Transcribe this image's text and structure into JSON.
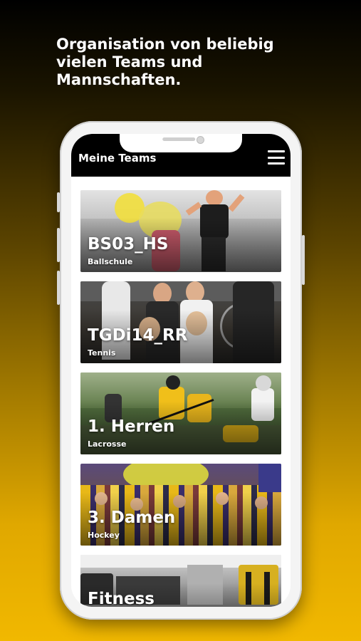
{
  "headline": "Organisation von beliebig\nvielen Teams und\nMannschaften.",
  "app": {
    "title": "Meine Teams",
    "menu_icon": "hamburger-menu-icon"
  },
  "teams": [
    {
      "name": "BS03_HS",
      "sport": "Ballschule"
    },
    {
      "name": "TGDi14_RR",
      "sport": "Tennis"
    },
    {
      "name": "1. Herren",
      "sport": "Lacrosse"
    },
    {
      "name": "3. Damen",
      "sport": "Hockey"
    },
    {
      "name": "Fitness",
      "sport": ""
    }
  ],
  "colors": {
    "accent": "#f1b800",
    "appbar": "#000000"
  }
}
